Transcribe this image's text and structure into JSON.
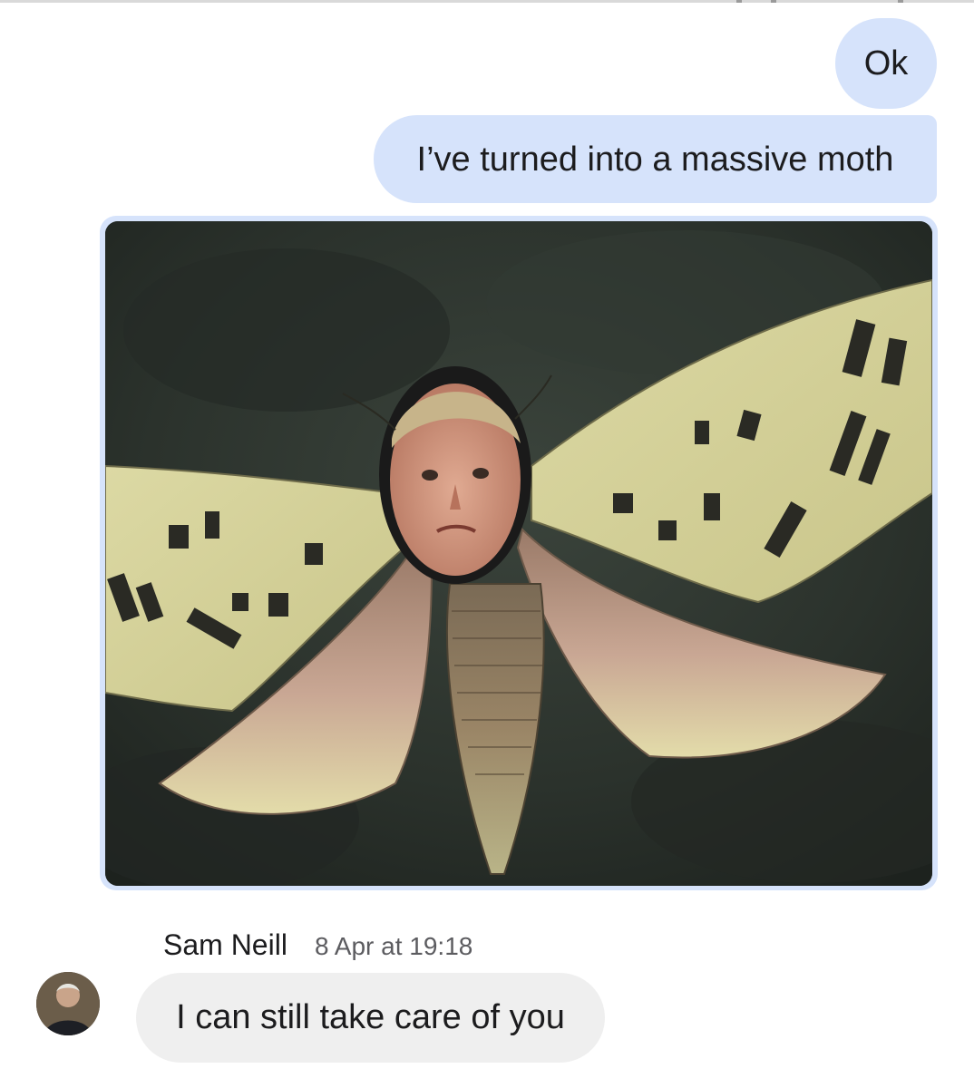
{
  "conversation": {
    "messages_out": [
      {
        "text": "Ok"
      },
      {
        "text": "I’ve turned into a massive moth"
      }
    ],
    "photo": {
      "description_icon": "moth-collage-photo"
    },
    "incoming": {
      "sender": "Sam Neill",
      "timestamp": "8 Apr at 19:18",
      "text": "I can still take care of you"
    }
  },
  "colors": {
    "outgoing_bubble": "#d6e3fb",
    "incoming_bubble": "#efefef",
    "text": "#1c1c1e",
    "timestamp": "#5c5c60"
  }
}
